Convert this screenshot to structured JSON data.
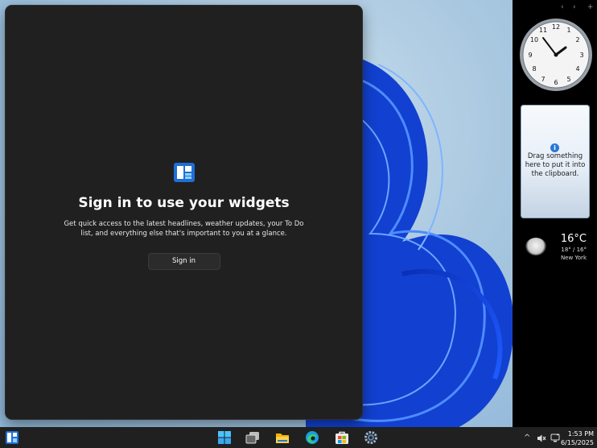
{
  "widgets": {
    "title": "Sign in to use your widgets",
    "description": "Get quick access to the latest headlines, weather updates, your To Do list, and everything else that's important to you at a glance.",
    "signin_label": "Sign in"
  },
  "sidebar": {
    "prev_label": "‹",
    "next_label": "›",
    "add_label": "+",
    "clock": {
      "time": "1:53",
      "numbers": [
        "12",
        "1",
        "2",
        "3",
        "4",
        "5",
        "6",
        "7",
        "8",
        "9",
        "10",
        "11"
      ]
    },
    "clipboard": {
      "info_glyph": "i",
      "text": "Drag something here to put it into the clipboard."
    },
    "weather": {
      "temperature": "16°C",
      "range": "18° / 16°",
      "city": "New York"
    }
  },
  "taskbar": {
    "time": "1:53 PM",
    "date": "6/15/2025",
    "icons": [
      "widgets-icon",
      "start-icon",
      "task-view-icon",
      "file-explorer-icon",
      "edge-icon",
      "store-icon",
      "settings-icon"
    ],
    "tray": {
      "chevron": "^"
    }
  },
  "colors": {
    "panel": "#202020",
    "taskbar": "#202020",
    "accent": "#2a78d6"
  }
}
